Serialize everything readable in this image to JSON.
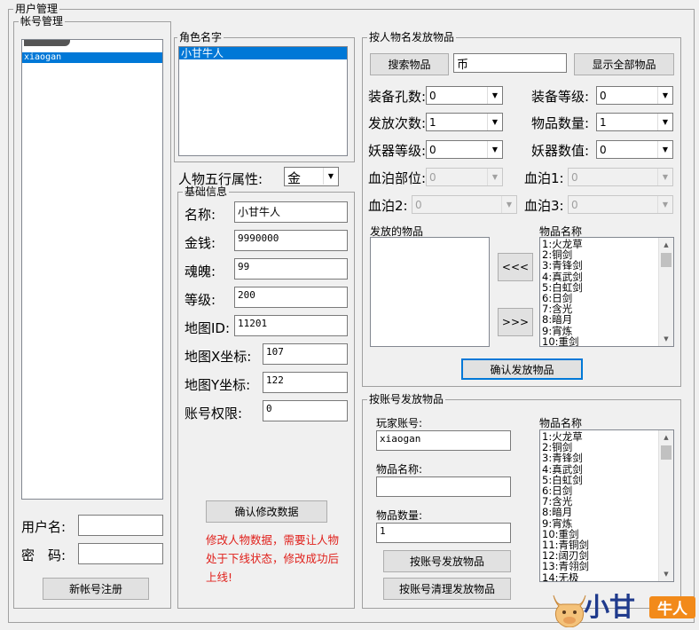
{
  "window": {
    "group_title": "用户管理"
  },
  "account": {
    "legend": "帐号管理",
    "selected_item": "xiaogan",
    "username_label": "用户名:",
    "password_label": "密　码:",
    "username_value": "",
    "password_value": "",
    "register_button": "新帐号注册"
  },
  "role": {
    "legend": "角色名字",
    "selected_role": "小甘牛人",
    "five_element_label": "人物五行属性:",
    "five_element_value": "金"
  },
  "basic": {
    "legend": "基础信息",
    "fields": [
      {
        "label": "名称:",
        "value": "小甘牛人"
      },
      {
        "label": "金钱:",
        "value": "9990000"
      },
      {
        "label": "魂魄:",
        "value": "99"
      },
      {
        "label": "等级:",
        "value": "200"
      },
      {
        "label": "地图ID:",
        "value": "11201"
      },
      {
        "label": "地图X坐标:",
        "value": "107"
      },
      {
        "label": "地图Y坐标:",
        "value": "122"
      },
      {
        "label": "账号权限:",
        "value": "0"
      }
    ],
    "confirm_button": "确认修改数据",
    "warning": "修改人物数据，需要让人物处于下线状态，修改成功后上线!"
  },
  "by_name": {
    "legend": "按人物名发放物品",
    "search_button": "搜索物品",
    "search_value": "币",
    "show_all_button": "显示全部物品",
    "combos": [
      {
        "label": "装备孔数:",
        "value": "0"
      },
      {
        "label": "装备等级:",
        "value": "0"
      },
      {
        "label": "发放次数:",
        "value": "1"
      },
      {
        "label": "物品数量:",
        "value": "1"
      },
      {
        "label": "妖器等级:",
        "value": "0"
      },
      {
        "label": "妖器数值:",
        "value": "0"
      },
      {
        "label": "血泊部位:",
        "value": "0"
      },
      {
        "label": "血泊1:",
        "value": "0"
      },
      {
        "label": "血泊2:",
        "value": "0"
      },
      {
        "label": "血泊3:",
        "value": "0"
      }
    ],
    "issued_label": "发放的物品",
    "item_name_label": "物品名称",
    "move_left_button": "<<<",
    "move_right_button": ">>>",
    "items": [
      "1:火龙草",
      "2:铜剑",
      "3:青锋剑",
      "4:真武剑",
      "5:白虹剑",
      "6:日剑",
      "7:含光",
      "8:暗月",
      "9:宵炼",
      "10:重剑"
    ],
    "confirm_button": "确认发放物品"
  },
  "by_account": {
    "legend": "按账号发放物品",
    "player_label": "玩家账号:",
    "player_value": "xiaogan",
    "item_name_label": "物品名称:",
    "item_name_value": "",
    "qty_label": "物品数量:",
    "qty_value": "1",
    "send_button": "按账号发放物品",
    "clear_button": "按账号清理发放物品",
    "list_label": "物品名称",
    "items": [
      "1:火龙草",
      "2:铜剑",
      "3:青锋剑",
      "4:真武剑",
      "5:白虹剑",
      "6:日剑",
      "7:含光",
      "8:暗月",
      "9:宵炼",
      "10:重剑",
      "11:青铜剑",
      "12:阔刃剑",
      "13:青翎剑",
      "14:无极"
    ]
  },
  "logo": {
    "text_main": "小甘",
    "text_badge": "牛人"
  }
}
